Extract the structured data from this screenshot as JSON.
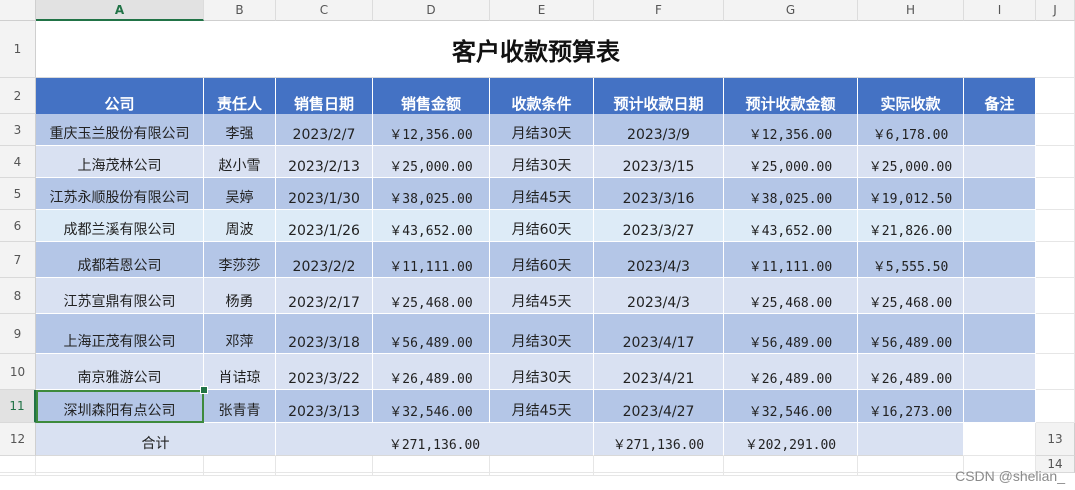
{
  "columns": [
    "A",
    "B",
    "C",
    "D",
    "E",
    "F",
    "G",
    "H",
    "I",
    "J"
  ],
  "active_column": "A",
  "rows": [
    "1",
    "2",
    "3",
    "4",
    "5",
    "6",
    "7",
    "8",
    "9",
    "10",
    "11",
    "12",
    "13",
    "14"
  ],
  "active_row": "11",
  "title": "客户收款预算表",
  "headers": [
    "公司",
    "责任人",
    "销售日期",
    "销售金额",
    "收款条件",
    "预计收款日期",
    "预计收款金额",
    "实际收款",
    "备注"
  ],
  "data_rows": [
    {
      "company": "重庆玉兰股份有限公司",
      "owner": "李强",
      "sale_date": "2023/2/7",
      "amount": "￥12,356.00",
      "terms": "月结30天",
      "due_date": "2023/3/9",
      "expected": "￥12,356.00",
      "actual": "￥6,178.00",
      "note": "",
      "shade": "a"
    },
    {
      "company": "上海茂林公司",
      "owner": "赵小雪",
      "sale_date": "2023/2/13",
      "amount": "￥25,000.00",
      "terms": "月结30天",
      "due_date": "2023/3/15",
      "expected": "￥25,000.00",
      "actual": "￥25,000.00",
      "note": "",
      "shade": "b"
    },
    {
      "company": "江苏永顺股份有限公司",
      "owner": "吴婷",
      "sale_date": "2023/1/30",
      "amount": "￥38,025.00",
      "terms": "月结45天",
      "due_date": "2023/3/16",
      "expected": "￥38,025.00",
      "actual": "￥19,012.50",
      "note": "",
      "shade": "a"
    },
    {
      "company": "成都兰溪有限公司",
      "owner": "周波",
      "sale_date": "2023/1/26",
      "amount": "￥43,652.00",
      "terms": "月结60天",
      "due_date": "2023/3/27",
      "expected": "￥43,652.00",
      "actual": "￥21,826.00",
      "note": "",
      "shade": "c"
    },
    {
      "company": "成都若恩公司",
      "owner": "李莎莎",
      "sale_date": "2023/2/2",
      "amount": "￥11,111.00",
      "terms": "月结60天",
      "due_date": "2023/4/3",
      "expected": "￥11,111.00",
      "actual": "￥5,555.50",
      "note": "",
      "shade": "a"
    },
    {
      "company": "江苏宣鼎有限公司",
      "owner": "杨勇",
      "sale_date": "2023/2/17",
      "amount": "￥25,468.00",
      "terms": "月结45天",
      "due_date": "2023/4/3",
      "expected": "￥25,468.00",
      "actual": "￥25,468.00",
      "note": "",
      "shade": "b"
    },
    {
      "company": "上海正茂有限公司",
      "owner": "邓萍",
      "sale_date": "2023/3/18",
      "amount": "￥56,489.00",
      "terms": "月结30天",
      "due_date": "2023/4/17",
      "expected": "￥56,489.00",
      "actual": "￥56,489.00",
      "note": "",
      "shade": "a"
    },
    {
      "company": "南京雅游公司",
      "owner": "肖诘琼",
      "sale_date": "2023/3/22",
      "amount": "￥26,489.00",
      "terms": "月结30天",
      "due_date": "2023/4/21",
      "expected": "￥26,489.00",
      "actual": "￥26,489.00",
      "note": "",
      "shade": "b"
    },
    {
      "company": "深圳森阳有点公司",
      "owner": "张青青",
      "sale_date": "2023/3/13",
      "amount": "￥32,546.00",
      "terms": "月结45天",
      "due_date": "2023/4/27",
      "expected": "￥32,546.00",
      "actual": "￥16,273.00",
      "note": "",
      "shade": "a"
    }
  ],
  "totals": {
    "label": "合计",
    "sales": "￥271,136.00",
    "expected": "￥271,136.00",
    "actual": "￥202,291.00"
  },
  "watermark": "CSDN @shelian_"
}
